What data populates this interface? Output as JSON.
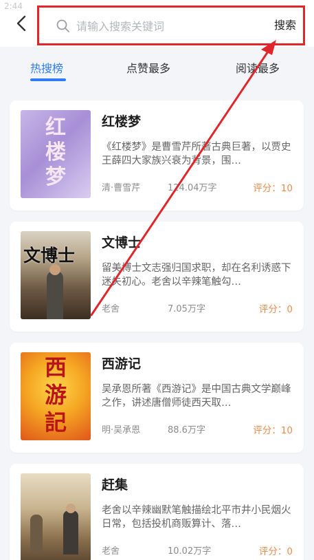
{
  "status_time": "2:44",
  "search": {
    "placeholder": "请输入搜索关键词",
    "value": "",
    "button_label": "搜索"
  },
  "tabs": [
    {
      "label": "热搜榜",
      "active": true
    },
    {
      "label": "点赞最多",
      "active": false
    },
    {
      "label": "阅读最多",
      "active": false
    }
  ],
  "books": [
    {
      "title": "红楼梦",
      "desc": "《红楼梦》是曹雪芹所著古典巨著，以贾史王薛四大家族兴衰为背景，围…",
      "author": "清·曹雪芹",
      "words": "124.04万字",
      "score": "评分：10",
      "cover_text": "红楼梦"
    },
    {
      "title": "文博士",
      "desc": "留美博士文志强归国求职，却在名利诱惑下迷失初心。老舍以辛辣笔触勾…",
      "author": "老舍",
      "words": "7.05万字",
      "score": "评分：0",
      "cover_text": "文博士"
    },
    {
      "title": "西游记",
      "desc": "吴承恩所著《西游记》是中国古典文学巅峰之作，讲述唐僧师徒西天取…",
      "author": "明·吴承恩",
      "words": "88.6万字",
      "score": "评分：10",
      "cover_text": "西游記"
    },
    {
      "title": "赶集",
      "desc": "老舍以辛辣幽默笔触描绘北平市井小民烟火日常，包括投机商贩算计、落…",
      "author": "老舍",
      "words": "10.02万字",
      "score": "评分：0",
      "cover_text": ""
    }
  ],
  "colors": {
    "accent": "#2f7df6",
    "score": "#f08a4b",
    "annotation": "#e0262b"
  }
}
